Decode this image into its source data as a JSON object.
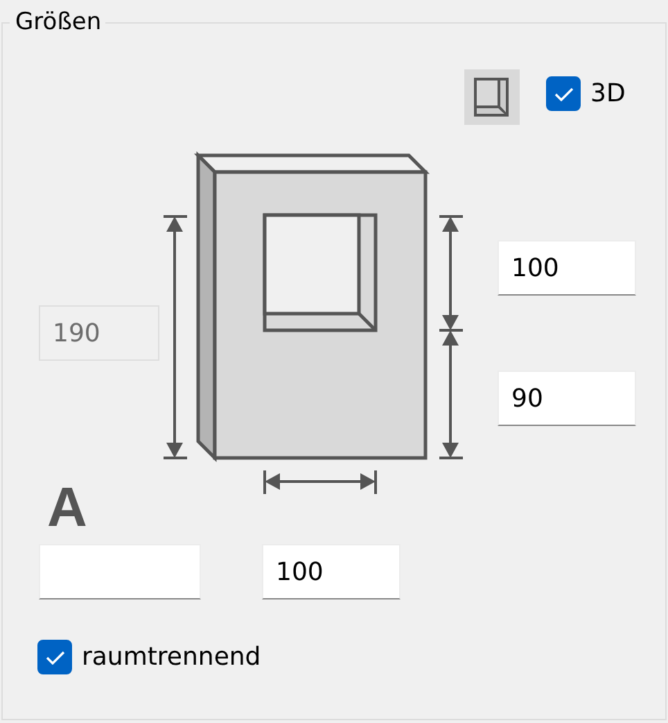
{
  "group_title": "Größen",
  "view_toggle": {
    "selected": true
  },
  "checkbox_3d": {
    "label": "3D",
    "checked": true
  },
  "total_height": {
    "value": "190",
    "disabled": true
  },
  "window_height": {
    "value": "100",
    "disabled": false
  },
  "sill_height": {
    "value": "90",
    "disabled": false
  },
  "marker": "A",
  "field_a": {
    "disabled": false
  },
  "window_width": {
    "value": "100",
    "disabled": false
  },
  "partition": {
    "label": "raumtrennend",
    "checked": true
  }
}
